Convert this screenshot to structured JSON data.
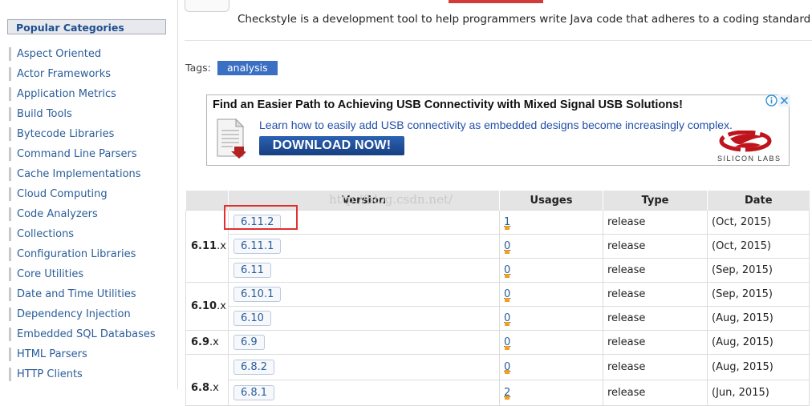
{
  "sidebar": {
    "header": "Popular Categories",
    "categories": [
      "Aspect Oriented",
      "Actor Frameworks",
      "Application Metrics",
      "Build Tools",
      "Bytecode Libraries",
      "Command Line Parsers",
      "Cache Implementations",
      "Cloud Computing",
      "Code Analyzers",
      "Collections",
      "Configuration Libraries",
      "Core Utilities",
      "Date and Time Utilities",
      "Dependency Injection",
      "Embedded SQL Databases",
      "HTML Parsers",
      "HTTP Clients"
    ]
  },
  "artifact": {
    "description": "Checkstyle is a development tool to help programmers write Java code that adheres to a coding standard",
    "tags_label": "Tags:",
    "tags": [
      "analysis"
    ]
  },
  "ad": {
    "headline": "Find an Easier Path to Achieving USB Connectivity with Mixed Signal USB Solutions!",
    "body": "Learn how to easily add USB connectivity as embedded designs become increasingly complex.",
    "cta": "DOWNLOAD NOW!",
    "logo_text": "SILICON LABS"
  },
  "versions_table": {
    "headers": {
      "version": "Version",
      "usages": "Usages",
      "type": "Type",
      "date": "Date"
    },
    "watermark": "http://blog.csdn.net/",
    "rows": [
      {
        "group": "6.11",
        "group_suffix": ".x",
        "version": "6.11.2",
        "usages": "1",
        "type": "release",
        "date": "(Oct, 2015)"
      },
      {
        "version": "6.11.1",
        "usages": "0",
        "type": "release",
        "date": "(Oct, 2015)"
      },
      {
        "version": "6.11",
        "usages": "0",
        "type": "release",
        "date": "(Sep, 2015)"
      },
      {
        "group": "6.10",
        "group_suffix": ".x",
        "version": "6.10.1",
        "usages": "0",
        "type": "release",
        "date": "(Sep, 2015)"
      },
      {
        "version": "6.10",
        "usages": "0",
        "type": "release",
        "date": "(Aug, 2015)"
      },
      {
        "group": "6.9",
        "group_suffix": ".x",
        "version": "6.9",
        "usages": "0",
        "type": "release",
        "date": "(Aug, 2015)"
      },
      {
        "group": "6.8",
        "group_suffix": ".x",
        "version": "6.8.2",
        "usages": "0",
        "type": "release",
        "date": "(Aug, 2015)"
      },
      {
        "version": "6.8.1",
        "usages": "2",
        "type": "release",
        "date": "(Jun, 2015)"
      }
    ]
  },
  "colors": {
    "link": "#2a5d9a",
    "tag_bg": "#3a6fc4",
    "highlight": "#e03030",
    "usage_bar": "#f0a020"
  }
}
